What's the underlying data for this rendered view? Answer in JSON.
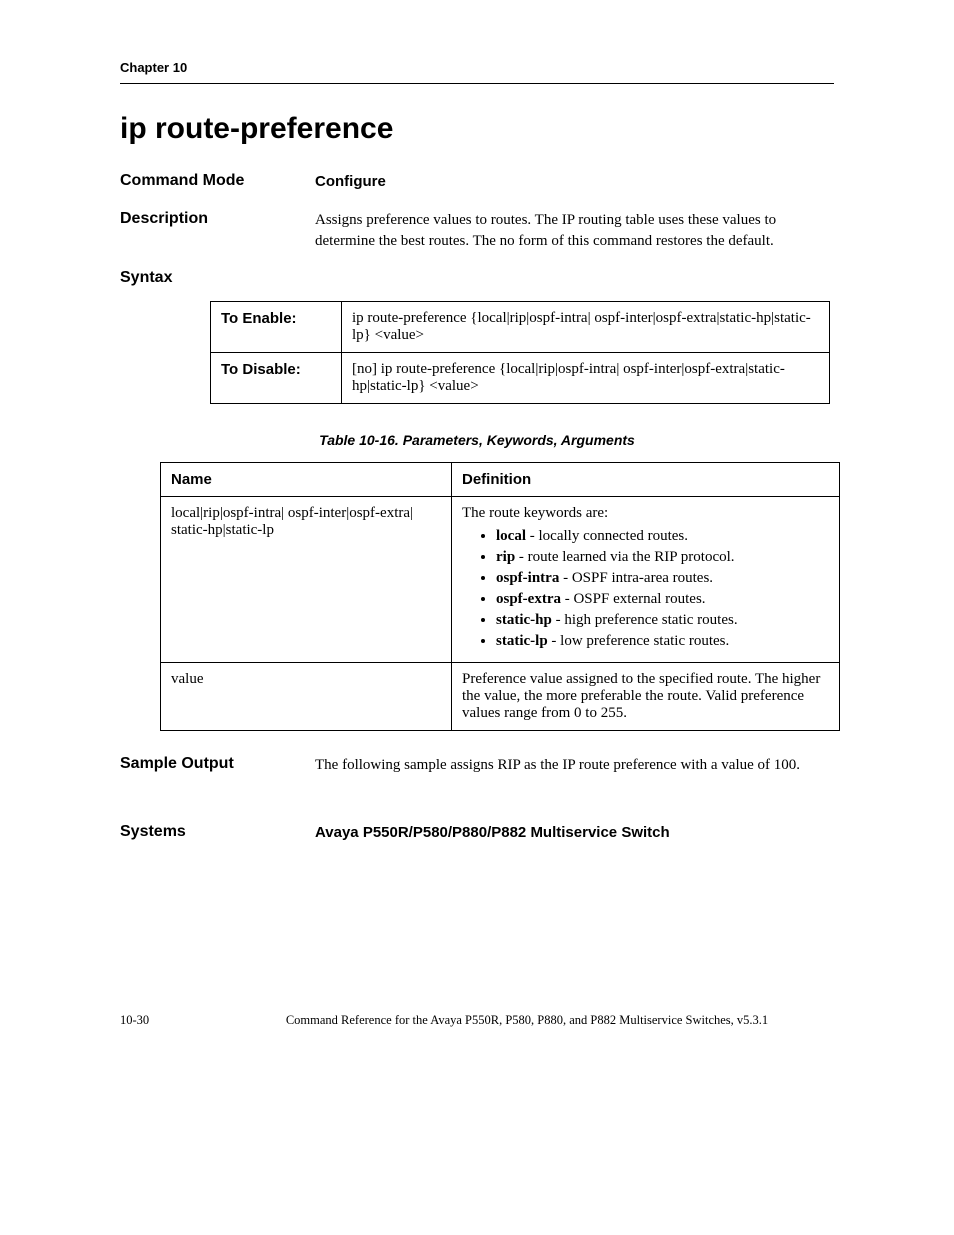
{
  "chapter": "Chapter 10",
  "title": "ip route-preference",
  "sections": {
    "command_mode": {
      "label": "Command Mode",
      "value": "Configure"
    },
    "description": {
      "label": "Description",
      "value": "Assigns preference values to routes. The IP routing table uses these values to determine the best routes. The no form of this command restores the default."
    },
    "syntax": {
      "label": "Syntax",
      "rows": [
        {
          "label": "To Enable:",
          "text": "ip route-preference {local|rip|ospf-intra| ospf-inter|ospf-extra|static-hp|static-lp} <value>"
        },
        {
          "label": "To Disable:",
          "text": "[no] ip route-preference {local|rip|ospf-intra| ospf-inter|ospf-extra|static-hp|static-lp} <value>"
        }
      ]
    },
    "params_caption": "Table 10-16.  Parameters, Keywords, Arguments",
    "params_headers": {
      "name": "Name",
      "definition": "Definition"
    },
    "params_rows": {
      "row0": {
        "name": "local|rip|ospf-intra| ospf-inter|ospf-extra| static-hp|static-lp",
        "intro": "The route keywords are:",
        "items": [
          {
            "kw": "local",
            "desc": " - locally connected routes."
          },
          {
            "kw": "rip",
            "desc": " -  route learned via the RIP protocol."
          },
          {
            "kw": "ospf-intra",
            "desc": " - OSPF intra-area routes."
          },
          {
            "kw": "ospf-extra",
            "desc": " - OSPF external routes."
          },
          {
            "kw": "static-hp",
            "desc": " - high preference static routes."
          },
          {
            "kw": "static-lp",
            "desc": " - low preference static routes."
          }
        ]
      },
      "row1": {
        "name": "value",
        "definition": "Preference value assigned to the specified route. The higher the value, the more preferable the route. Valid preference values range from 0 to 255."
      }
    },
    "sample_output": {
      "label": "Sample Output",
      "value": "The following sample assigns RIP as the IP route preference with a value of 100."
    },
    "systems": {
      "label": "Systems",
      "value": "Avaya P550R/P580/P880/P882 Multiservice Switch"
    }
  },
  "footer": {
    "page": "10-30",
    "book": "Command Reference for the Avaya P550R, P580, P880, and P882 Multiservice Switches, v5.3.1"
  }
}
